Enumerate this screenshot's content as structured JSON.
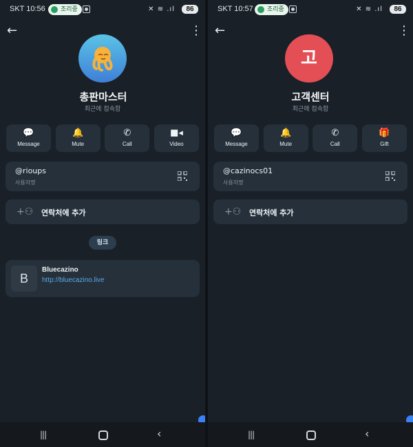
{
  "screens": [
    {
      "status": {
        "time": "SKT 10:56",
        "pill": "조리중",
        "battery": "86"
      },
      "avatar_text": "",
      "avatar_icon": "octopus-emoji-icon",
      "name": "총판마스터",
      "subtitle": "최근에 접속함",
      "actions": [
        {
          "label": "Message",
          "icon": "chat-bubble-icon"
        },
        {
          "label": "Mute",
          "icon": "bell-icon"
        },
        {
          "label": "Call",
          "icon": "phone-icon"
        },
        {
          "label": "Video",
          "icon": "video-camera-icon"
        }
      ],
      "username": "@rioups",
      "username_label": "사용자명",
      "add_contact": "연락처에 추가",
      "links_label": "링크",
      "link": {
        "thumb": "B",
        "title": "Bluecazino",
        "url": "http://bluecazino.live"
      }
    },
    {
      "status": {
        "time": "SKT 10:57",
        "pill": "조리중",
        "battery": "86"
      },
      "avatar_text": "고",
      "name": "고객센터",
      "subtitle": "최근에 접속함",
      "actions": [
        {
          "label": "Message",
          "icon": "chat-bubble-icon"
        },
        {
          "label": "Mute",
          "icon": "bell-icon"
        },
        {
          "label": "Call",
          "icon": "phone-icon"
        },
        {
          "label": "Gift",
          "icon": "gift-icon"
        }
      ],
      "username": "@cazinocs01",
      "username_label": "사용자명",
      "add_contact": "연락처에 추가"
    }
  ],
  "colors": {
    "background": "#1a2027",
    "card": "#25303a",
    "accent_link": "#5da8e8",
    "avatar_red": "#e34f55",
    "avatar_blue": "#3f7fd8"
  }
}
